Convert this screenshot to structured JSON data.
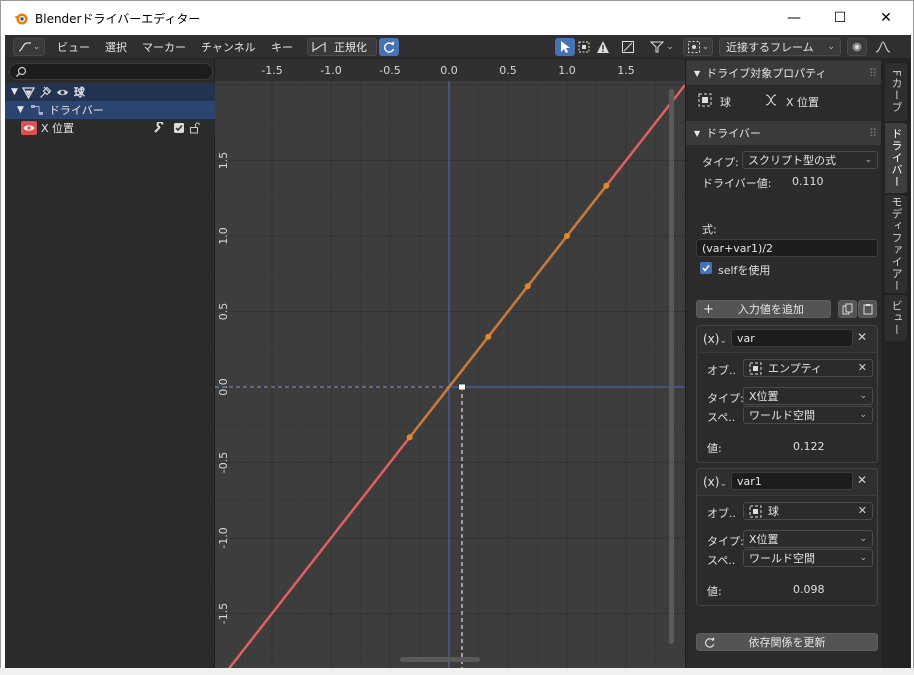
{
  "window": {
    "title": "Blenderドライバーエディター",
    "minimize": "—",
    "maximize": "☐",
    "close": "✕"
  },
  "header": {
    "menus": [
      "ビュー",
      "選択",
      "マーカー",
      "チャンネル",
      "キー"
    ],
    "normalize_label": "正規化",
    "snap_label": "近接するフレーム"
  },
  "outliner": {
    "object_label": "球",
    "drivers_label": "ドライバー",
    "channel_label": "X 位置"
  },
  "graph": {
    "x_ticks": [
      "-1.5",
      "-1.0",
      "-0.5",
      "0.0",
      "0.5",
      "1.0",
      "1.5"
    ],
    "y_ticks": [
      "1.5",
      "1.0",
      "0.5",
      "0.0",
      "-0.5",
      "-1.0",
      "-1.5"
    ],
    "curve_color": "#e06060",
    "curve_highlight_color": "#c47a3a",
    "axis_color": "#4a6fbf",
    "cursor_line_color": "#ffffff"
  },
  "sidebar": {
    "drive_target_header": "ドライブ対象プロパティ",
    "target_object": "球",
    "target_property": "X 位置",
    "driver_header": "ドライバー",
    "type_label": "タイプ:",
    "type_value": "スクリプト型の式",
    "driver_value_label": "ドライバー値:",
    "driver_value": "0.110",
    "expression_label": "式:",
    "expression": "(var+var1)/2",
    "use_self_label": "selfを使用",
    "add_input_label": "入力値を追加",
    "update_deps_label": "依存関係を更新",
    "variables": [
      {
        "name": "var",
        "object_label": "オブ..",
        "object": "エンプティ",
        "type_label": "タイプ:",
        "type": "X位置",
        "space_label": "スペ..",
        "space": "ワールド空間",
        "value_label": "値:",
        "value": "0.122"
      },
      {
        "name": "var1",
        "object_label": "オブ..",
        "object": "球",
        "type_label": "タイプ:",
        "type": "X位置",
        "space_label": "スペ..",
        "space": "ワールド空間",
        "value_label": "値:",
        "value": "0.098"
      }
    ]
  },
  "tabs": [
    "Fカーブ",
    "ドライバー",
    "モディファイアー",
    "ビュー"
  ]
}
